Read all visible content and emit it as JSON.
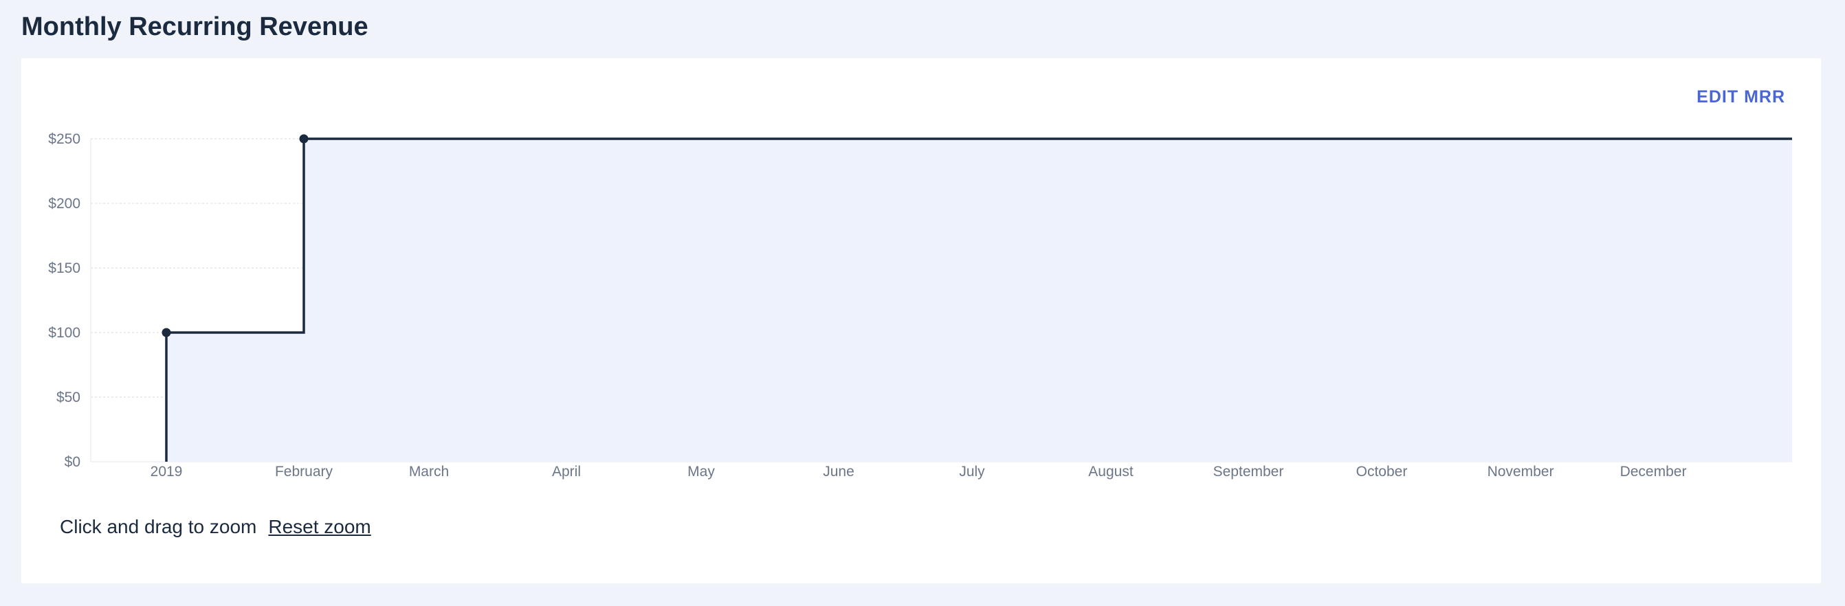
{
  "header": {
    "title": "Monthly Recurring Revenue"
  },
  "actions": {
    "edit_label": "EDIT MRR"
  },
  "footer": {
    "zoom_hint": "Click and drag to zoom",
    "reset_label": "Reset zoom"
  },
  "colors": {
    "line": "#1b2a3f",
    "fill": "#eef2fc",
    "grid": "#d7dbe3",
    "accent": "#4a66d4"
  },
  "chart_data": {
    "type": "area",
    "step": true,
    "x_tick_labels": [
      "2019",
      "February",
      "March",
      "April",
      "May",
      "June",
      "July",
      "August",
      "September",
      "October",
      "November",
      "December"
    ],
    "y_tick_labels": [
      "$0",
      "$50",
      "$100",
      "$150",
      "$200",
      "$250"
    ],
    "ylim": [
      0,
      250
    ],
    "series": [
      {
        "points": [
          {
            "x": "2019-01-01",
            "y": 100
          },
          {
            "x": "2019-02-01",
            "y": 250
          },
          {
            "x": "2019-12-31",
            "y": 250
          }
        ]
      }
    ],
    "markers": [
      {
        "x": "2019-01-01",
        "y": 100
      },
      {
        "x": "2019-02-01",
        "y": 250
      }
    ],
    "grid": true
  }
}
